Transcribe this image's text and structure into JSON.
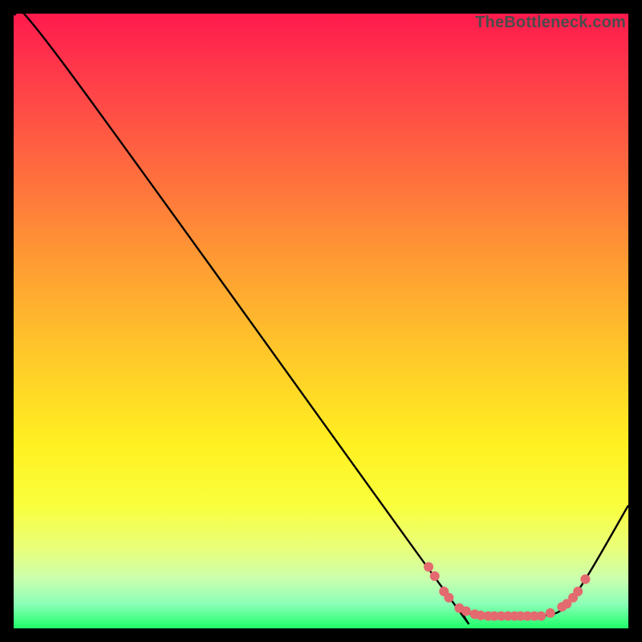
{
  "watermark": "TheBottleneck.com",
  "chart_data": {
    "type": "line",
    "title": "",
    "xlabel": "",
    "ylabel": "",
    "xlim": [
      0,
      100
    ],
    "ylim": [
      0,
      100
    ],
    "series": [
      {
        "name": "curve",
        "x": [
          0,
          8,
          68,
          73,
          78,
          86,
          91,
          100
        ],
        "y": [
          100,
          92,
          9,
          3,
          2,
          2,
          5,
          20
        ]
      }
    ],
    "markers": {
      "name": "highlight-points",
      "color": "#e36a6f",
      "points": [
        {
          "x": 67.5,
          "y": 10.0
        },
        {
          "x": 68.5,
          "y": 8.5
        },
        {
          "x": 70.0,
          "y": 6.0
        },
        {
          "x": 70.8,
          "y": 5.0
        },
        {
          "x": 72.5,
          "y": 3.3
        },
        {
          "x": 73.6,
          "y": 2.8
        },
        {
          "x": 75.0,
          "y": 2.3
        },
        {
          "x": 76.0,
          "y": 2.1
        },
        {
          "x": 77.2,
          "y": 2.0
        },
        {
          "x": 78.2,
          "y": 2.0
        },
        {
          "x": 79.3,
          "y": 2.0
        },
        {
          "x": 80.4,
          "y": 2.0
        },
        {
          "x": 81.5,
          "y": 2.0
        },
        {
          "x": 82.5,
          "y": 2.0
        },
        {
          "x": 83.6,
          "y": 2.0
        },
        {
          "x": 84.7,
          "y": 2.0
        },
        {
          "x": 85.8,
          "y": 2.0
        },
        {
          "x": 87.3,
          "y": 2.5
        },
        {
          "x": 89.2,
          "y": 3.5
        },
        {
          "x": 90.0,
          "y": 4.0
        },
        {
          "x": 91.0,
          "y": 5.0
        },
        {
          "x": 91.8,
          "y": 6.0
        },
        {
          "x": 93.0,
          "y": 8.0
        }
      ]
    }
  }
}
